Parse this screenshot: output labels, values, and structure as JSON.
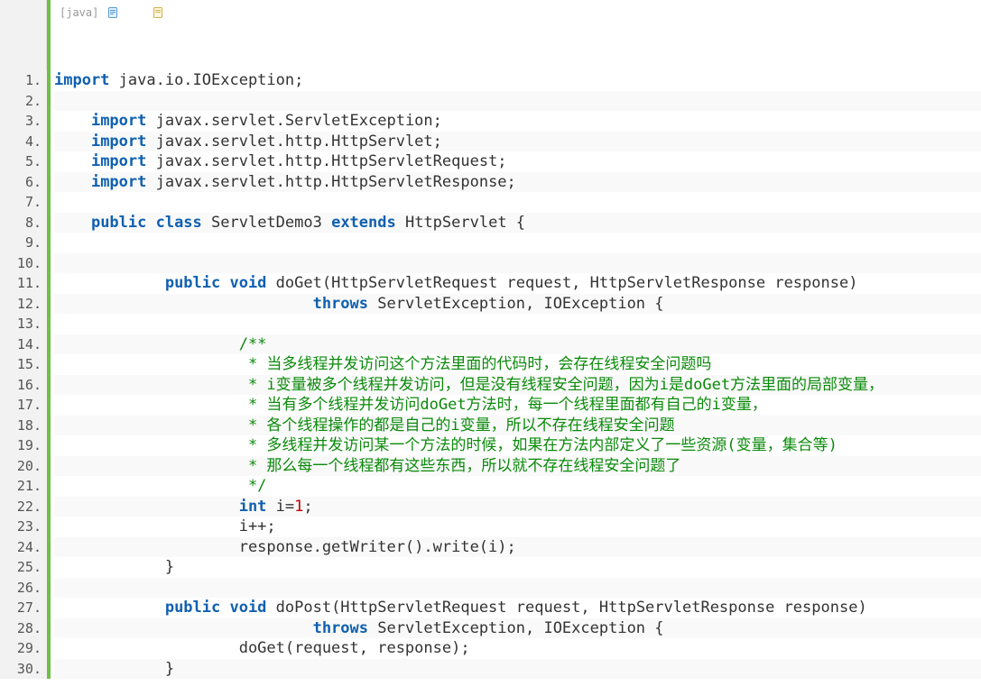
{
  "toolbar": {
    "language_label": "[java]"
  },
  "code": {
    "lines": [
      {
        "indent": 0,
        "tokens": [
          {
            "t": "kw",
            "v": "import"
          },
          {
            "t": "txt",
            "v": " java.io.IOException;"
          }
        ]
      },
      {
        "indent": 0,
        "tokens": []
      },
      {
        "indent": 1,
        "tokens": [
          {
            "t": "kw",
            "v": "import"
          },
          {
            "t": "txt",
            "v": " javax.servlet.ServletException;"
          }
        ]
      },
      {
        "indent": 1,
        "tokens": [
          {
            "t": "kw",
            "v": "import"
          },
          {
            "t": "txt",
            "v": " javax.servlet.http.HttpServlet;"
          }
        ]
      },
      {
        "indent": 1,
        "tokens": [
          {
            "t": "kw",
            "v": "import"
          },
          {
            "t": "txt",
            "v": " javax.servlet.http.HttpServletRequest;"
          }
        ]
      },
      {
        "indent": 1,
        "tokens": [
          {
            "t": "kw",
            "v": "import"
          },
          {
            "t": "txt",
            "v": " javax.servlet.http.HttpServletResponse;"
          }
        ]
      },
      {
        "indent": 0,
        "tokens": []
      },
      {
        "indent": 1,
        "tokens": [
          {
            "t": "kw",
            "v": "public class"
          },
          {
            "t": "txt",
            "v": " ServletDemo3 "
          },
          {
            "t": "kw",
            "v": "extends"
          },
          {
            "t": "txt",
            "v": " HttpServlet {"
          }
        ]
      },
      {
        "indent": 0,
        "tokens": []
      },
      {
        "indent": 0,
        "tokens": []
      },
      {
        "indent": 3,
        "tokens": [
          {
            "t": "kw",
            "v": "public void"
          },
          {
            "t": "txt",
            "v": " doGet(HttpServletRequest request, HttpServletResponse response)"
          }
        ]
      },
      {
        "indent": 7,
        "tokens": [
          {
            "t": "kw",
            "v": "throws"
          },
          {
            "t": "txt",
            "v": " ServletException, IOException {"
          }
        ]
      },
      {
        "indent": 0,
        "tokens": []
      },
      {
        "indent": 5,
        "tokens": [
          {
            "t": "cmt",
            "v": "/**"
          }
        ]
      },
      {
        "indent": 5,
        "tokens": [
          {
            "t": "cmt",
            "v": " * 当多线程并发访问这个方法里面的代码时，会存在线程安全问题吗"
          }
        ]
      },
      {
        "indent": 5,
        "tokens": [
          {
            "t": "cmt",
            "v": " * i变量被多个线程并发访问，但是没有线程安全问题，因为i是doGet方法里面的局部变量，"
          }
        ]
      },
      {
        "indent": 5,
        "tokens": [
          {
            "t": "cmt",
            "v": " * 当有多个线程并发访问doGet方法时，每一个线程里面都有自己的i变量，"
          }
        ]
      },
      {
        "indent": 5,
        "tokens": [
          {
            "t": "cmt",
            "v": " * 各个线程操作的都是自己的i变量，所以不存在线程安全问题"
          }
        ]
      },
      {
        "indent": 5,
        "tokens": [
          {
            "t": "cmt",
            "v": " * 多线程并发访问某一个方法的时候，如果在方法内部定义了一些资源(变量，集合等)"
          }
        ]
      },
      {
        "indent": 5,
        "tokens": [
          {
            "t": "cmt",
            "v": " * 那么每一个线程都有这些东西，所以就不存在线程安全问题了"
          }
        ]
      },
      {
        "indent": 5,
        "tokens": [
          {
            "t": "cmt",
            "v": " */"
          }
        ]
      },
      {
        "indent": 5,
        "tokens": [
          {
            "t": "kw",
            "v": "int"
          },
          {
            "t": "txt",
            "v": " i="
          },
          {
            "t": "num",
            "v": "1"
          },
          {
            "t": "txt",
            "v": ";"
          }
        ]
      },
      {
        "indent": 5,
        "tokens": [
          {
            "t": "txt",
            "v": "i++;"
          }
        ]
      },
      {
        "indent": 5,
        "tokens": [
          {
            "t": "txt",
            "v": "response.getWriter().write(i);"
          }
        ]
      },
      {
        "indent": 3,
        "tokens": [
          {
            "t": "txt",
            "v": "}"
          }
        ]
      },
      {
        "indent": 0,
        "tokens": []
      },
      {
        "indent": 3,
        "tokens": [
          {
            "t": "kw",
            "v": "public void"
          },
          {
            "t": "txt",
            "v": " doPost(HttpServletRequest request, HttpServletResponse response)"
          }
        ]
      },
      {
        "indent": 7,
        "tokens": [
          {
            "t": "kw",
            "v": "throws"
          },
          {
            "t": "txt",
            "v": " ServletException, IOException {"
          }
        ]
      },
      {
        "indent": 5,
        "tokens": [
          {
            "t": "txt",
            "v": "doGet(request, response);"
          }
        ]
      },
      {
        "indent": 3,
        "tokens": [
          {
            "t": "txt",
            "v": "}"
          }
        ]
      }
    ]
  }
}
